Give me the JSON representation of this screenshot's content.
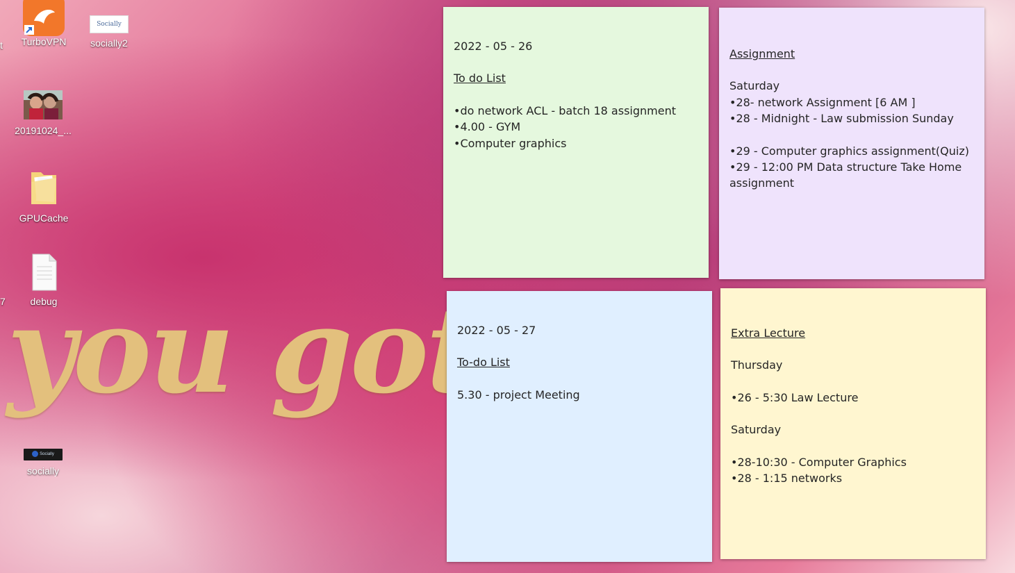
{
  "desktop": {
    "icons": [
      {
        "label": "TurboVPN"
      },
      {
        "label": "socially2",
        "badge": "Socially"
      },
      {
        "label": "20191024_..."
      },
      {
        "label": "GPUCache"
      },
      {
        "label": "debug"
      },
      {
        "label": "socially",
        "badge": "Socially"
      }
    ],
    "edge_chars": [
      "t",
      "7"
    ],
    "wallpaper_text": "you got"
  },
  "notes": {
    "n1": {
      "color": "#e5f8de",
      "date": "2022 - 05 - 26",
      "heading": "To do List",
      "items": [
        "do network ACL - batch 18 assignment",
        "4.00 - GYM",
        "Computer graphics"
      ]
    },
    "n2": {
      "color": "#efe3fc",
      "heading": "Assignment",
      "day": "Saturday",
      "items_a": [
        "28- network Assignment [6 AM ]",
        "28 - Midnight - Law submission Sunday"
      ],
      "items_b": [
        "29 - Computer graphics assignment(Quiz)",
        "29 - 12:00 PM Data structure Take Home assignment"
      ]
    },
    "n3": {
      "color": "#e0efff",
      "date": "2022 - 05 - 27",
      "heading": "To-do List",
      "line": "5.30 - project Meeting"
    },
    "n4": {
      "color": "#fff6d0",
      "heading": "Extra Lecture",
      "day1": "Thursday",
      "items_a": [
        "26 - 5:30 Law Lecture"
      ],
      "day2": "Saturday",
      "items_b": [
        "28-10:30 - Computer Graphics",
        "28 - 1:15 networks"
      ]
    }
  }
}
